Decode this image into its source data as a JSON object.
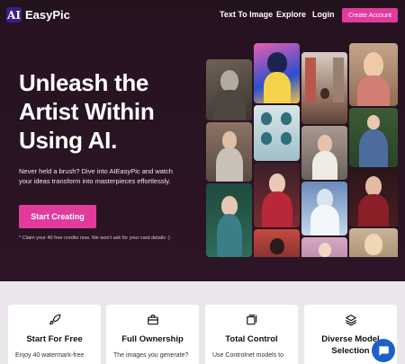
{
  "nav": {
    "logo_mark": "AI",
    "brand": "EasyPic",
    "links": [
      "Text To Image",
      "Explore",
      "Login"
    ],
    "cta": "Create Account"
  },
  "hero": {
    "headline": "Unleash the Artist Within Using AI.",
    "subtitle": "Never held a brush? Dive into AIEasyPic and watch your ideas transform into masterpieces effortlessly.",
    "cta": "Start Creating",
    "claim": "* Claim your 40 free credits now. We won't ask for your card details :)"
  },
  "features": [
    {
      "icon": "rocket-icon",
      "title": "Start For Free",
      "text": "Enjoy 40 watermark-free"
    },
    {
      "icon": "briefcase-icon",
      "title": "Full Ownership",
      "text": "The images you generate?"
    },
    {
      "icon": "crop-icon",
      "title": "Total Control",
      "text": "Use Controlnet models to"
    },
    {
      "icon": "layers-icon",
      "title": "Diverse Model Selection",
      "text": ""
    }
  ],
  "colors": {
    "accent": "#e23a9d",
    "hero_bg": "#25121f",
    "logo_bg": "#3a1f86",
    "chat": "#1e60c7"
  }
}
